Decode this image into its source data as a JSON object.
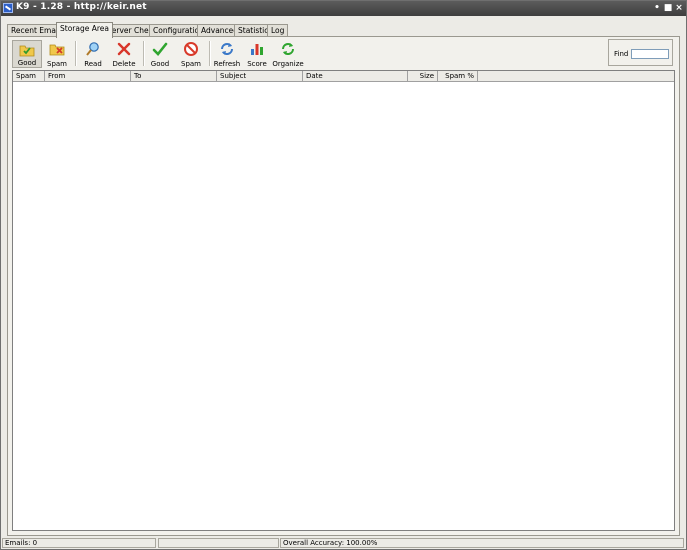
{
  "window": {
    "title": "K9 - 1.28 - http://keir.net"
  },
  "tabs": [
    {
      "label": "Recent Emails"
    },
    {
      "label": "Storage Area"
    },
    {
      "label": "Server Check"
    },
    {
      "label": "Configuration"
    },
    {
      "label": "Advanced"
    },
    {
      "label": "Statistics"
    },
    {
      "label": "Log"
    }
  ],
  "active_tab": "Storage Area",
  "toolbar": {
    "good_filter": "Good",
    "spam_filter": "Spam",
    "read": "Read",
    "delete": "Delete",
    "mark_good": "Good",
    "mark_spam": "Spam",
    "refresh": "Refresh",
    "score": "Score",
    "organize": "Organize"
  },
  "find": {
    "label": "Find",
    "value": ""
  },
  "columns": [
    "Spam",
    "From",
    "To",
    "Subject",
    "Date",
    "Size",
    "Spam %"
  ],
  "rows": [],
  "status": {
    "emails": "Emails: 0",
    "accuracy": "Overall Accuracy: 100.00%"
  },
  "colors": {
    "title_bar": "#4a4a4a",
    "panel": "#f2f1ec",
    "grid_bg": "#ffffff"
  }
}
